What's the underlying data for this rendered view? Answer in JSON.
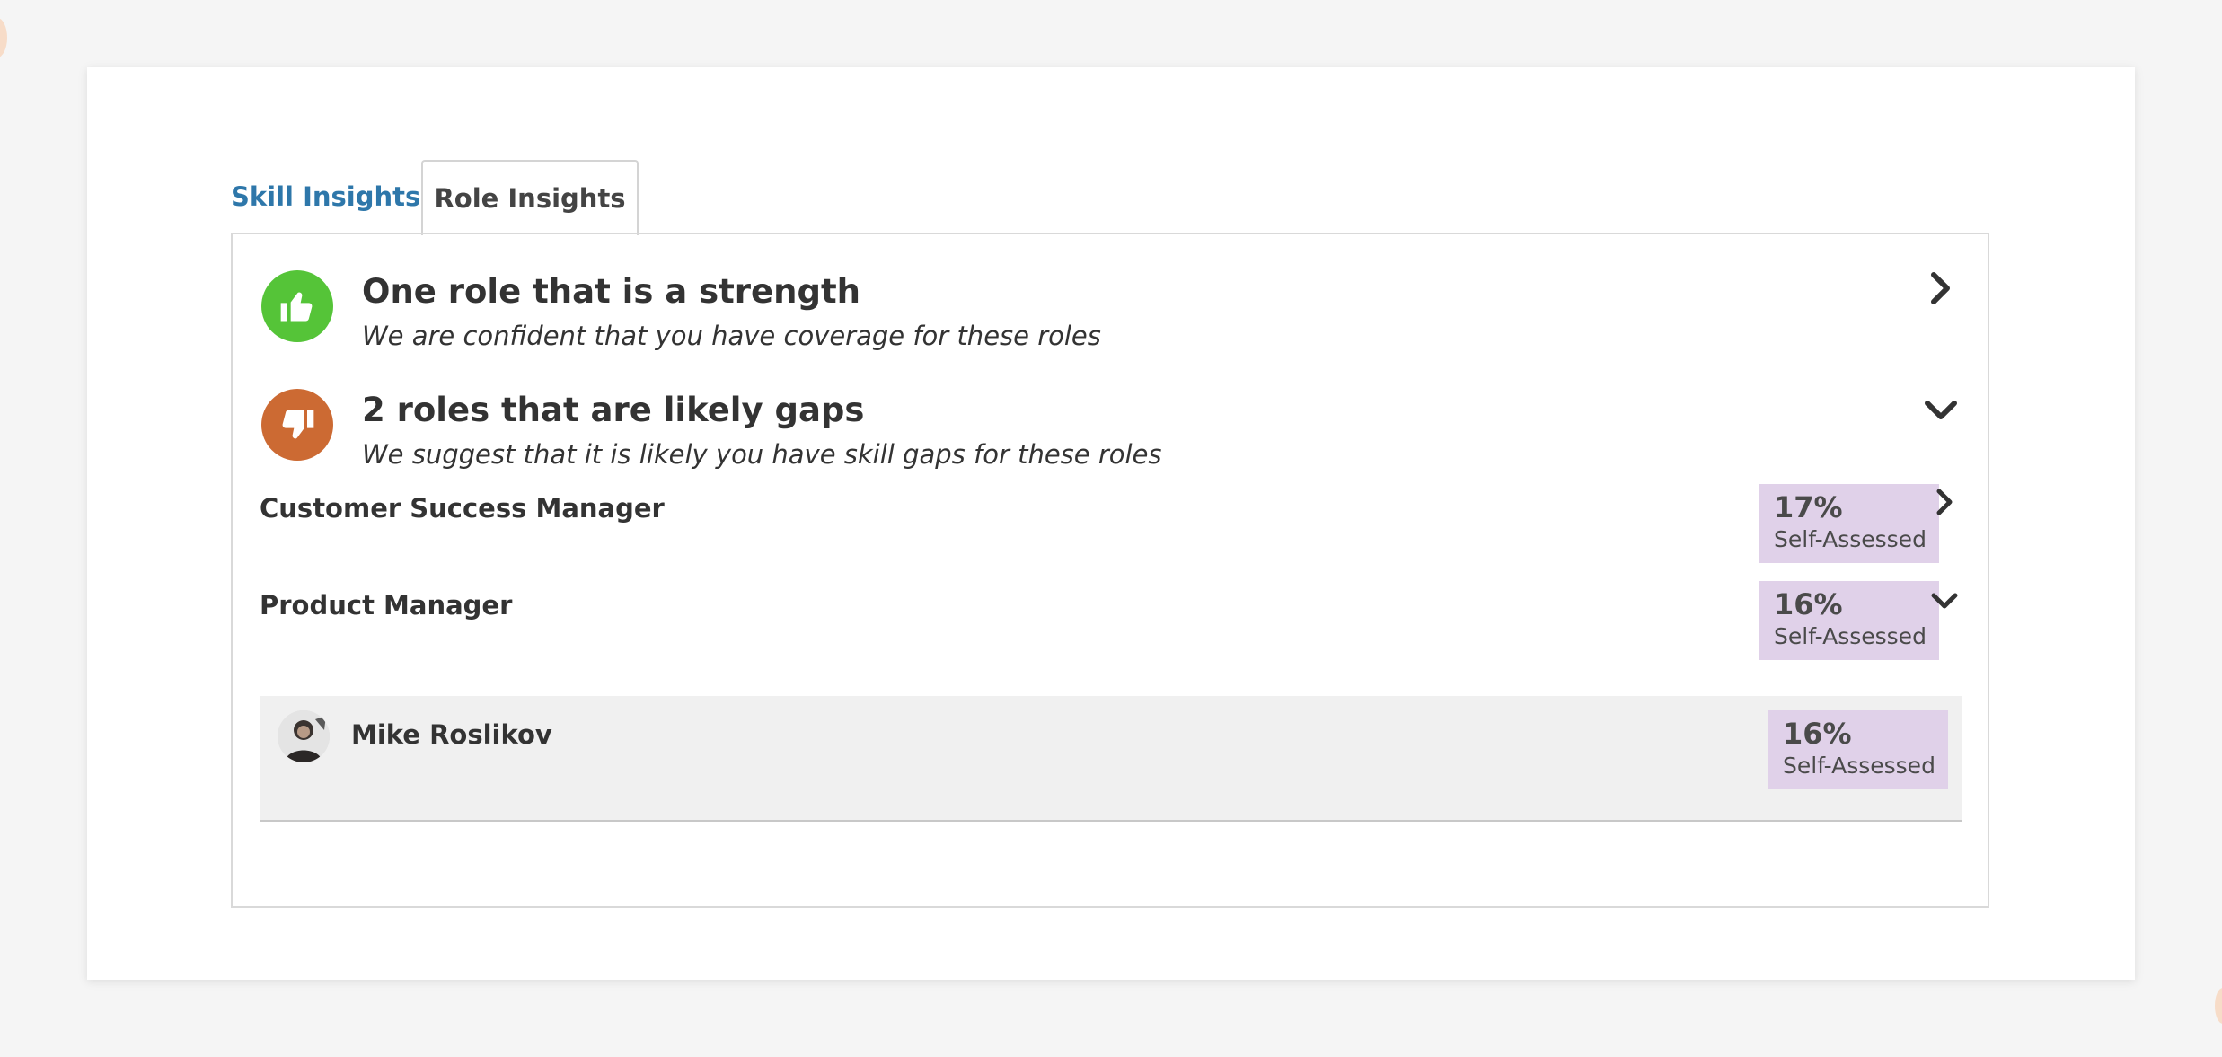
{
  "tabs": {
    "skill": "Skill Insights",
    "role": "Role Insights",
    "active": "Role Insights"
  },
  "insights": {
    "strength": {
      "title": "One role that is a strength",
      "subtitle": "We are confident that you have coverage for these roles",
      "icon": "thumbs-up-icon",
      "color": "#55c438",
      "state": "collapsed"
    },
    "gaps": {
      "title": "2 roles that are likely gaps",
      "subtitle": "We suggest that it is likely you have skill gaps for these roles",
      "icon": "thumbs-down-icon",
      "color": "#cc6a33",
      "state": "expanded"
    }
  },
  "roles": [
    {
      "name": "Customer Success Manager",
      "score": "17%",
      "score_label": "Self-Assessed",
      "state": "collapsed"
    },
    {
      "name": "Product Manager",
      "score": "16%",
      "score_label": "Self-Assessed",
      "state": "expanded"
    }
  ],
  "members": [
    {
      "name": "Mike Roslikov",
      "score": "16%",
      "score_label": "Self-Assessed"
    }
  ],
  "colors": {
    "link": "#2e77aa",
    "score_bg": "#e0d1e9",
    "strength": "#55c438",
    "gap": "#cc6a33"
  }
}
